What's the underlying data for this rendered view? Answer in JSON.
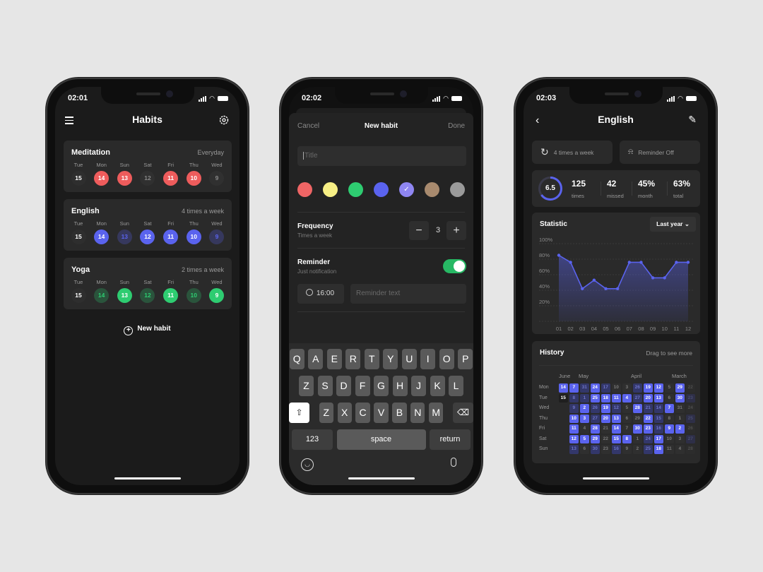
{
  "phones": [
    {
      "time": "02:01"
    },
    {
      "time": "02:02"
    },
    {
      "time": "02:03"
    }
  ],
  "habits_screen": {
    "title": "Habits",
    "icons": {
      "menu": "hamburger-icon",
      "settings": "gear-icon",
      "add": "plus-circle-icon"
    },
    "habits": [
      {
        "name": "Meditation",
        "frequency": "Everyday",
        "color": "#ee5c5c",
        "days": [
          {
            "d": "Tue",
            "n": "15",
            "s": "today"
          },
          {
            "d": "Mon",
            "n": "14",
            "s": "done"
          },
          {
            "d": "Sun",
            "n": "13",
            "s": "done"
          },
          {
            "d": "Sat",
            "n": "12",
            "s": "missed"
          },
          {
            "d": "Fri",
            "n": "11",
            "s": "done"
          },
          {
            "d": "Thu",
            "n": "10",
            "s": "done"
          },
          {
            "d": "Wed",
            "n": "9",
            "s": "missed"
          }
        ]
      },
      {
        "name": "English",
        "frequency": "4 times a week",
        "color": "#5a63ee",
        "days": [
          {
            "d": "Tue",
            "n": "15",
            "s": "today"
          },
          {
            "d": "Mon",
            "n": "14",
            "s": "done"
          },
          {
            "d": "Sun",
            "n": "13",
            "s": "skip"
          },
          {
            "d": "Sat",
            "n": "12",
            "s": "done"
          },
          {
            "d": "Fri",
            "n": "11",
            "s": "done"
          },
          {
            "d": "Thu",
            "n": "10",
            "s": "done"
          },
          {
            "d": "Wed",
            "n": "9",
            "s": "skip"
          }
        ]
      },
      {
        "name": "Yoga",
        "frequency": "2 times a week",
        "color": "#2ecc71",
        "days": [
          {
            "d": "Tue",
            "n": "15",
            "s": "today"
          },
          {
            "d": "Mon",
            "n": "14",
            "s": "skip"
          },
          {
            "d": "Sun",
            "n": "13",
            "s": "done"
          },
          {
            "d": "Sat",
            "n": "12",
            "s": "skip"
          },
          {
            "d": "Fri",
            "n": "11",
            "s": "done"
          },
          {
            "d": "Thu",
            "n": "10",
            "s": "skip"
          },
          {
            "d": "Wed",
            "n": "9",
            "s": "done"
          }
        ]
      }
    ],
    "new_habit_label": "New habit"
  },
  "new_habit_screen": {
    "cancel": "Cancel",
    "title": "New habit",
    "done": "Done",
    "title_placeholder": "Title",
    "colors": [
      "#ef6565",
      "#f7ef85",
      "#2ecc71",
      "#5a63ee",
      "#8f86f2",
      "#a88a6e",
      "#9a9a9a"
    ],
    "selected_color_index": 4,
    "frequency_label": "Frequency",
    "frequency_sub": "Times a week",
    "frequency_value": "3",
    "reminder_label": "Reminder",
    "reminder_sub": "Just notification",
    "reminder_on": true,
    "reminder_time": "16:00",
    "reminder_text_placeholder": "Reminder text",
    "keyboard": {
      "row1": [
        "Q",
        "A",
        "E",
        "R",
        "T",
        "Y",
        "U",
        "I",
        "O",
        "P"
      ],
      "row2": [
        "Z",
        "S",
        "D",
        "F",
        "G",
        "H",
        "J",
        "K",
        "L"
      ],
      "row3": [
        "Z",
        "X",
        "C",
        "V",
        "B",
        "N",
        "M"
      ],
      "numbers": "123",
      "space": "space",
      "return": "return"
    }
  },
  "detail_screen": {
    "title": "English",
    "frequency_btn": "4 times a week",
    "reminder_btn": "Reminder Off",
    "ring_value": "6.5",
    "ring_fraction": 0.65,
    "stats": [
      {
        "v": "125",
        "l": "times"
      },
      {
        "v": "42",
        "l": "missed"
      },
      {
        "v": "45%",
        "l": "month"
      },
      {
        "v": "63%",
        "l": "total"
      }
    ],
    "statistic_title": "Statistic",
    "range": "Last year",
    "history_title": "History",
    "history_hint": "Drag to see more",
    "months": [
      "June",
      "May",
      "April",
      "March"
    ],
    "weekdays": [
      "Mon",
      "Tue",
      "Wed",
      "Thu",
      "Fri",
      "Sat",
      "Sun"
    ],
    "history": [
      [
        [
          "14",
          "on"
        ],
        [
          "7",
          "on"
        ],
        [
          "31",
          "dim"
        ],
        [
          "24",
          "on"
        ],
        [
          "17",
          "dim"
        ],
        [
          "10",
          "off"
        ],
        [
          "3",
          "off"
        ],
        [
          "26",
          "dim"
        ],
        [
          "19",
          "on"
        ],
        [
          "12",
          "on"
        ],
        [
          "5",
          "off"
        ],
        [
          "29",
          "on"
        ],
        [
          "22",
          "off"
        ]
      ],
      [
        [
          "15",
          "today"
        ],
        [
          "8",
          "dim"
        ],
        [
          "1",
          "dim"
        ],
        [
          "25",
          "on"
        ],
        [
          "18",
          "on"
        ],
        [
          "11",
          "on"
        ],
        [
          "4",
          "on"
        ],
        [
          "27",
          "dim"
        ],
        [
          "20",
          "on"
        ],
        [
          "13",
          "on"
        ],
        [
          "6",
          "off"
        ],
        [
          "30",
          "on"
        ],
        [
          "23",
          "dim"
        ]
      ],
      [
        [
          "",
          ""
        ],
        [
          "9",
          "dim"
        ],
        [
          "2",
          "on"
        ],
        [
          "26",
          "dim"
        ],
        [
          "19",
          "on"
        ],
        [
          "12",
          "dim"
        ],
        [
          "5",
          "off"
        ],
        [
          "28",
          "on"
        ],
        [
          "21",
          "dim"
        ],
        [
          "14",
          "dim"
        ],
        [
          "7",
          "on"
        ],
        [
          "31",
          "off"
        ],
        [
          "24",
          "off"
        ]
      ],
      [
        [
          "",
          ""
        ],
        [
          "10",
          "on"
        ],
        [
          "3",
          "on"
        ],
        [
          "27",
          "dim"
        ],
        [
          "20",
          "on"
        ],
        [
          "13",
          "on"
        ],
        [
          "6",
          "off"
        ],
        [
          "29",
          "off"
        ],
        [
          "22",
          "on"
        ],
        [
          "15",
          "dim"
        ],
        [
          "8",
          "off"
        ],
        [
          "1",
          "off"
        ],
        [
          "25",
          "dim"
        ]
      ],
      [
        [
          "",
          ""
        ],
        [
          "11",
          "on"
        ],
        [
          "4",
          "off"
        ],
        [
          "28",
          "on"
        ],
        [
          "21",
          "off"
        ],
        [
          "14",
          "on"
        ],
        [
          "7",
          "off"
        ],
        [
          "30",
          "on"
        ],
        [
          "23",
          "on"
        ],
        [
          "16",
          "dim"
        ],
        [
          "9",
          "on"
        ],
        [
          "2",
          "on"
        ],
        [
          "26",
          "off"
        ]
      ],
      [
        [
          "",
          ""
        ],
        [
          "12",
          "on"
        ],
        [
          "5",
          "on"
        ],
        [
          "29",
          "on"
        ],
        [
          "22",
          "off"
        ],
        [
          "15",
          "on"
        ],
        [
          "8",
          "on"
        ],
        [
          "1",
          "off"
        ],
        [
          "24",
          "dim"
        ],
        [
          "17",
          "on"
        ],
        [
          "10",
          "off"
        ],
        [
          "3",
          "off"
        ],
        [
          "27",
          "dim"
        ]
      ],
      [
        [
          "",
          ""
        ],
        [
          "13",
          "dim"
        ],
        [
          "6",
          "off"
        ],
        [
          "30",
          "dim"
        ],
        [
          "23",
          "off"
        ],
        [
          "16",
          "dim"
        ],
        [
          "9",
          "off"
        ],
        [
          "2",
          "off"
        ],
        [
          "25",
          "dim"
        ],
        [
          "18",
          "on"
        ],
        [
          "11",
          "off"
        ],
        [
          "4",
          "off"
        ],
        [
          "28",
          "off"
        ]
      ]
    ]
  },
  "chart_data": {
    "type": "area",
    "categories": [
      "01",
      "02",
      "03",
      "04",
      "05",
      "06",
      "07",
      "08",
      "09",
      "10",
      "11",
      "12"
    ],
    "values": [
      85,
      76,
      42,
      53,
      42,
      42,
      76,
      76,
      56,
      56,
      76,
      76
    ],
    "yticks": [
      "100%",
      "80%",
      "60%",
      "40%",
      "20%"
    ],
    "ylim": [
      0,
      100
    ],
    "grid": true,
    "color": "#5a63ee"
  }
}
